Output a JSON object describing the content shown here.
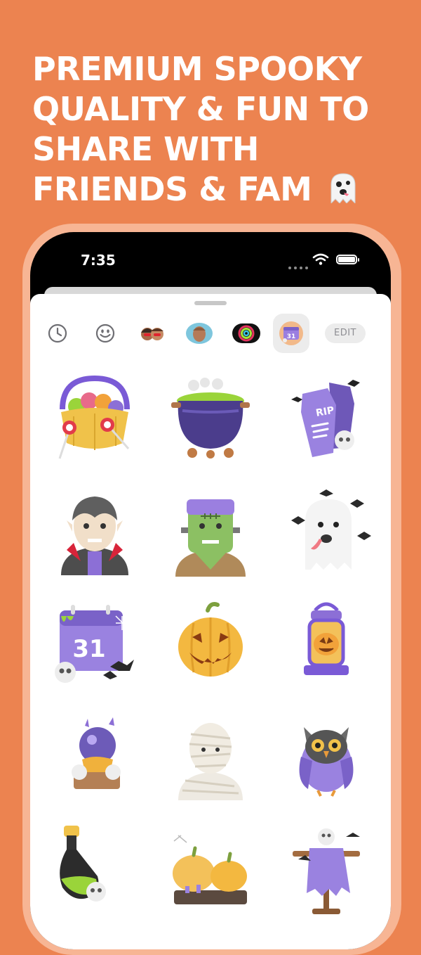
{
  "headline": {
    "lines": [
      "PREMIUM SPOOKY",
      "QUALITY & FUN TO",
      "SHARE WITH",
      "FRIENDS & FAM"
    ],
    "emoji_icon": "ghost-emoji-icon"
  },
  "status_bar": {
    "time": "7:35",
    "icons": [
      "signal-dots-icon",
      "wifi-icon",
      "battery-icon"
    ]
  },
  "sticker_tabs": [
    {
      "icon": "recent-clock-icon",
      "selected": false
    },
    {
      "icon": "emoji-smiley-icon",
      "selected": false
    },
    {
      "icon": "memoji-kids-icon",
      "selected": false
    },
    {
      "icon": "memoji-face-icon",
      "selected": false
    },
    {
      "icon": "activity-rings-icon",
      "selected": false
    },
    {
      "icon": "halloween-pack-icon",
      "selected": true
    }
  ],
  "edit_label": "EDIT",
  "stickers": [
    "candy-basket",
    "witch-cauldron",
    "rip-coffin",
    "vampire",
    "frankenstein",
    "ghost-with-bats",
    "calendar-31",
    "jack-o-lantern",
    "lantern",
    "crystal-ball",
    "mummy",
    "owl",
    "potion-bottle",
    "pumpkins-candles",
    "scarecrow"
  ],
  "colors": {
    "background": "#ec8350",
    "frame": "#f7b594",
    "purple": "#8c6fd6",
    "pumpkin": "#f0b13c",
    "slime": "#9ad43a"
  }
}
